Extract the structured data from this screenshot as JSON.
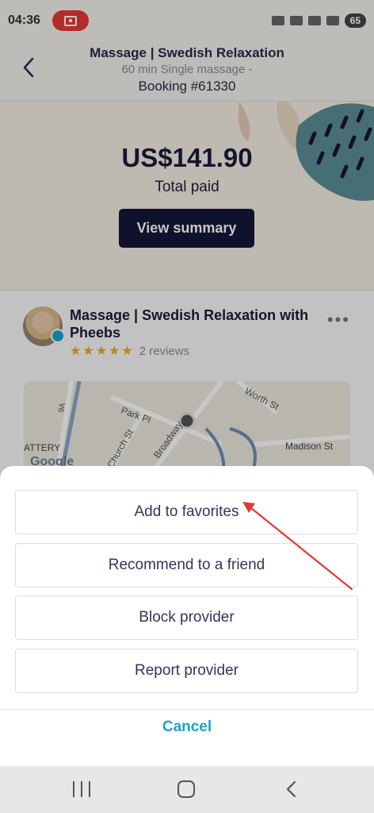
{
  "status_bar": {
    "time": "04:36",
    "battery": "65"
  },
  "header": {
    "title": "Massage | Swedish Relaxation",
    "subtitle": "60 min Single massage -",
    "booking": "Booking #61330"
  },
  "payment": {
    "amount": "US$141.90",
    "label": "Total paid",
    "view_summary": "View summary"
  },
  "provider": {
    "name": "Massage  |  Swedish Relaxation with Pheebs",
    "stars": [
      "★",
      "★",
      "★",
      "★",
      "★"
    ],
    "rating": 5,
    "reviews": "2 reviews",
    "more_icon": "more-dots-icon"
  },
  "map": {
    "labels": {
      "worth": "Worth St",
      "park": "Park Pl",
      "church": "Church St",
      "broadway": "Broadway",
      "madison": "Madison St",
      "battery": "ATTERY",
      "ninea": "9A",
      "google": "Google"
    }
  },
  "actions": {
    "add_favorites": "Add to favorites",
    "recommend": "Recommend to a friend",
    "block": "Block provider",
    "report": "Report provider",
    "cancel": "Cancel"
  },
  "colors": {
    "accent": "#1fa4c5",
    "primary_button": "#15163a",
    "star": "#f2a81d",
    "annotation_arrow": "#e53935"
  }
}
